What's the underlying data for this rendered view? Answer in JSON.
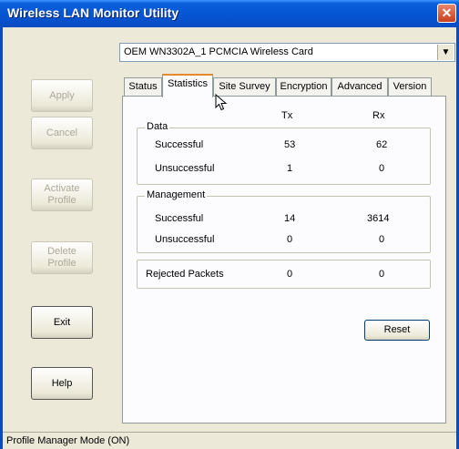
{
  "window": {
    "title": "Wireless LAN Monitor Utility"
  },
  "sidebar": {
    "apply": "Apply",
    "cancel": "Cancel",
    "activate_profile": [
      "Activate",
      "Profile"
    ],
    "delete_profile": [
      "Delete",
      "Profile"
    ],
    "exit": "Exit",
    "help": "Help"
  },
  "adapter": {
    "selected": "OEM WN3302A_1 PCMCIA Wireless Card"
  },
  "tabs": [
    {
      "label": "Status"
    },
    {
      "label": "Statistics"
    },
    {
      "label": "Site Survey"
    },
    {
      "label": "Encryption"
    },
    {
      "label": "Advanced"
    },
    {
      "label": "Version"
    }
  ],
  "stats": {
    "col_tx": "Tx",
    "col_rx": "Rx",
    "data": {
      "label": "Data",
      "rows": [
        {
          "label": "Successful",
          "tx": "53",
          "rx": "62"
        },
        {
          "label": "Unsuccessful",
          "tx": "1",
          "rx": "0"
        }
      ]
    },
    "management": {
      "label": "Management",
      "rows": [
        {
          "label": "Successful",
          "tx": "14",
          "rx": "3614"
        },
        {
          "label": "Unsuccessful",
          "tx": "0",
          "rx": "0"
        }
      ]
    },
    "rejected": {
      "label": "Rejected Packets",
      "tx": "0",
      "rx": "0"
    },
    "reset": "Reset"
  },
  "statusbar": {
    "text": "Profile Manager Mode (ON)"
  }
}
